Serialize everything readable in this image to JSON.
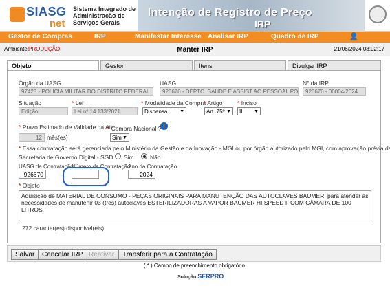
{
  "header": {
    "logo_text": "SIASG",
    "logo_sub": "net",
    "org_line1": "Sistema Integrado de",
    "org_line2": "Administração de",
    "org_line3": "Serviços Gerais",
    "banner_title": "Intenção de Registro de Preço",
    "banner_sub": "IRP"
  },
  "nav": {
    "items": [
      "Gestor de Compras",
      "IRP",
      "Manifestar Interesse",
      "Analisar IRP",
      "Quadro de IRP"
    ],
    "user_icon": "user-icon"
  },
  "env": {
    "label": "Ambiente:",
    "value": "PRODUÇÃO",
    "page_title": "Manter IRP",
    "datetime": "21/06/2024 08:02:17"
  },
  "tabs": [
    "Objeto",
    "Gestor",
    "Itens",
    "Divulgar IRP"
  ],
  "form": {
    "uasg_org_label": "Órgão da UASG",
    "uasg_org_value": "97428 - POLÍCIA MILITAR DO DISTRITO FEDERAL",
    "uasg_label": "UASG",
    "uasg_value": "926670 - DEPTO. SAUDE E ASSIST AO PESSOAL POL",
    "irp_label": "N° da IRP",
    "irp_value": "926670 - 00004/2024",
    "situacao_label": "Situação",
    "situacao_value": "Edição",
    "lei_label": "Lei",
    "lei_value": "Lei nº 14.133/2021",
    "modalidade_label": "Modalidade da Compra",
    "modalidade_value": "Dispensa",
    "artigo_label": "Artigo",
    "artigo_value": "Art. 75º",
    "inciso_label": "Inciso",
    "inciso_value": "II",
    "prazo_label": "Prazo Estimado de Validade da Ata",
    "prazo_value": "12",
    "prazo_unit": "mês(es)",
    "compra_nac_label": "Compra Nacional ?",
    "compra_nac_value": "Sim",
    "mgi_question_line1": "Essa contratação será gerenciada pelo Ministério da Gestão e da Inovação - MGI ou por órgão autorizado pelo MGI, com aprovação prévia da",
    "mgi_question_line2": "Secretaria de Governo Digital - SGD ?",
    "radio_sim": "Sim",
    "radio_nao": "Não",
    "uasg_contr_label": "UASG da Contratação",
    "uasg_contr_value": "926670",
    "num_contr_label": "Número da Contratação",
    "num_contr_value": "",
    "ano_contr_label": "Ano da Contratação",
    "ano_contr_value": "2024",
    "objeto_label": "Objeto",
    "objeto_value": "Aquisição de MATERIAL DE CONSUMO - PEÇAS ORIGINAIS PARA MANUTENÇÃO DAS AUTOCLAVES BAUMER, para atender às necessidades de manutenir 03 (três) autoclaves ESTERILIZADORAS A VAPOR BAUMER HI SPEED II COM CÂMARA DE 100 LITROS",
    "chars_left": "272 caracter(es) disponível(eis)"
  },
  "buttons": {
    "salvar": "Salvar",
    "cancelar": "Cancelar IRP",
    "reativar": "Reativar",
    "transferir": "Transferir para a Contratação"
  },
  "footer": {
    "required_note": "( * ) Campo de preenchimento obrigatório.",
    "solution_label": "Solução",
    "brand": "SERPRO"
  }
}
